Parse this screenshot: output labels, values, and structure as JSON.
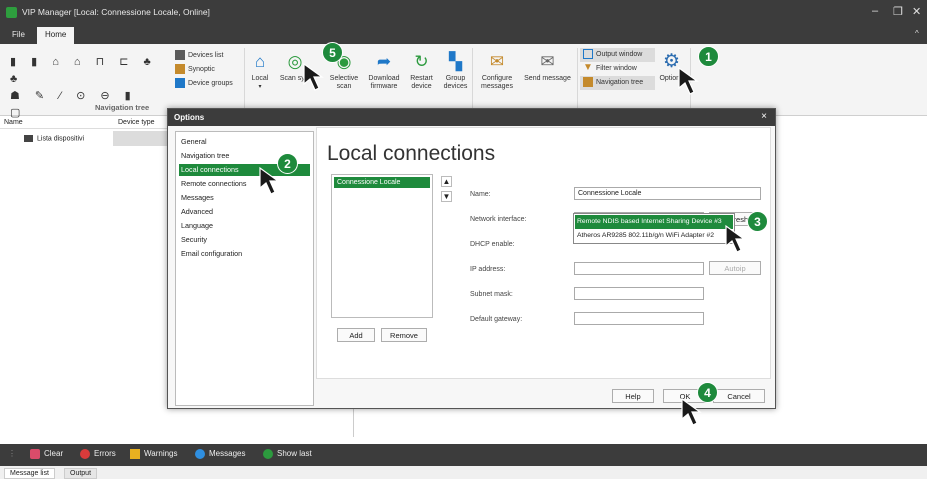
{
  "window": {
    "title": "VIP Manager [Local: Connessione Locale, Online]",
    "min": "–",
    "max": "❐",
    "close": "✕",
    "collapse": "^"
  },
  "menu": {
    "file": "File",
    "home": "Home"
  },
  "ribbon": {
    "devices_list": "Devices list",
    "synoptic": "Synoptic",
    "device_groups": "Device groups",
    "navigation_tree": "Navigation tree",
    "local": "Local",
    "scan_system": "Scan syst",
    "selective_scan": "Selective scan",
    "download_firmware": "Download firmware",
    "restart_device": "Restart device",
    "group_devices": "Group devices",
    "configure_messages": "Configure messages",
    "send_message": "Send message",
    "output_window": "Output window",
    "filter_window": "Filter window",
    "navigation_tree_win": "Navigation tree",
    "options": "Options",
    "colors": {
      "blue": "#1f78c8",
      "green": "#2c9a3e",
      "gear": "#2b6cb0"
    }
  },
  "tree": {
    "col_name": "Name",
    "col_type": "Device type",
    "root": "Lista dispositivi"
  },
  "dialog": {
    "title": "Options",
    "close": "×",
    "categories": [
      "General",
      "Navigation tree",
      "Local connections",
      "Remote connections",
      "Messages",
      "Advanced",
      "Language",
      "Security",
      "Email configuration"
    ],
    "selected_category": "Local connections",
    "panel_title": "Local connections",
    "connections": [
      "Connessione Locale"
    ],
    "add": "Add",
    "remove": "Remove",
    "fields": {
      "name_label": "Name:",
      "name_value": "Connessione Locale",
      "network_label": "Network interface:",
      "network_value": "",
      "refresh": "Refresh",
      "dhcp_label": "DHCP enable:",
      "ip_label": "IP address:",
      "autoip": "Autoip",
      "subnet_label": "Subnet mask:",
      "gateway_label": "Default gateway:"
    },
    "dropdown_options": [
      "Remote NDIS based Internet Sharing Device #3",
      "Atheros AR9285 802.11b/g/n WiFi Adapter #2"
    ],
    "help": "Help",
    "ok": "OK",
    "cancel": "Cancel"
  },
  "bottom": {
    "clear": "Clear",
    "errors": "Errors",
    "warnings": "Warnings",
    "messages": "Messages",
    "show_last": "Show last",
    "tab_messages": "Message list",
    "tab_output": "Output"
  },
  "callouts": [
    "1",
    "2",
    "3",
    "4",
    "5"
  ],
  "accent": "#1e8a3c"
}
